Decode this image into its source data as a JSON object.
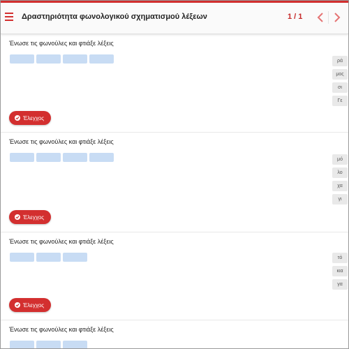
{
  "header": {
    "title": "Δραστηριότητα φωνολογικού σχηματισμού λέξεων",
    "page_counter": "1 / 1",
    "accent_color": "#d32f2f"
  },
  "exercises": [
    {
      "instruction": "Ένωσε τις φωνούλες και φτιάξε λέξεις",
      "slot_count": 4,
      "syllables": [
        "ρά",
        "μος",
        "σι",
        "Γε"
      ],
      "check_label": "Έλεγχος"
    },
    {
      "instruction": "Ένωσε τις φωνούλες και φτιάξε λέξεις",
      "slot_count": 4,
      "syllables": [
        "μό",
        "λο",
        "χα",
        "γι"
      ],
      "check_label": "Έλεγχος"
    },
    {
      "instruction": "Ένωσε τις φωνούλες και φτιάξε λέξεις",
      "slot_count": 3,
      "syllables": [
        "τό",
        "κια",
        "γα"
      ],
      "check_label": "Έλεγχος"
    },
    {
      "instruction": "Ένωσε τις φωνούλες και φτιάξε λέξεις",
      "slot_count": 3,
      "syllables": [],
      "check_label": ""
    }
  ]
}
